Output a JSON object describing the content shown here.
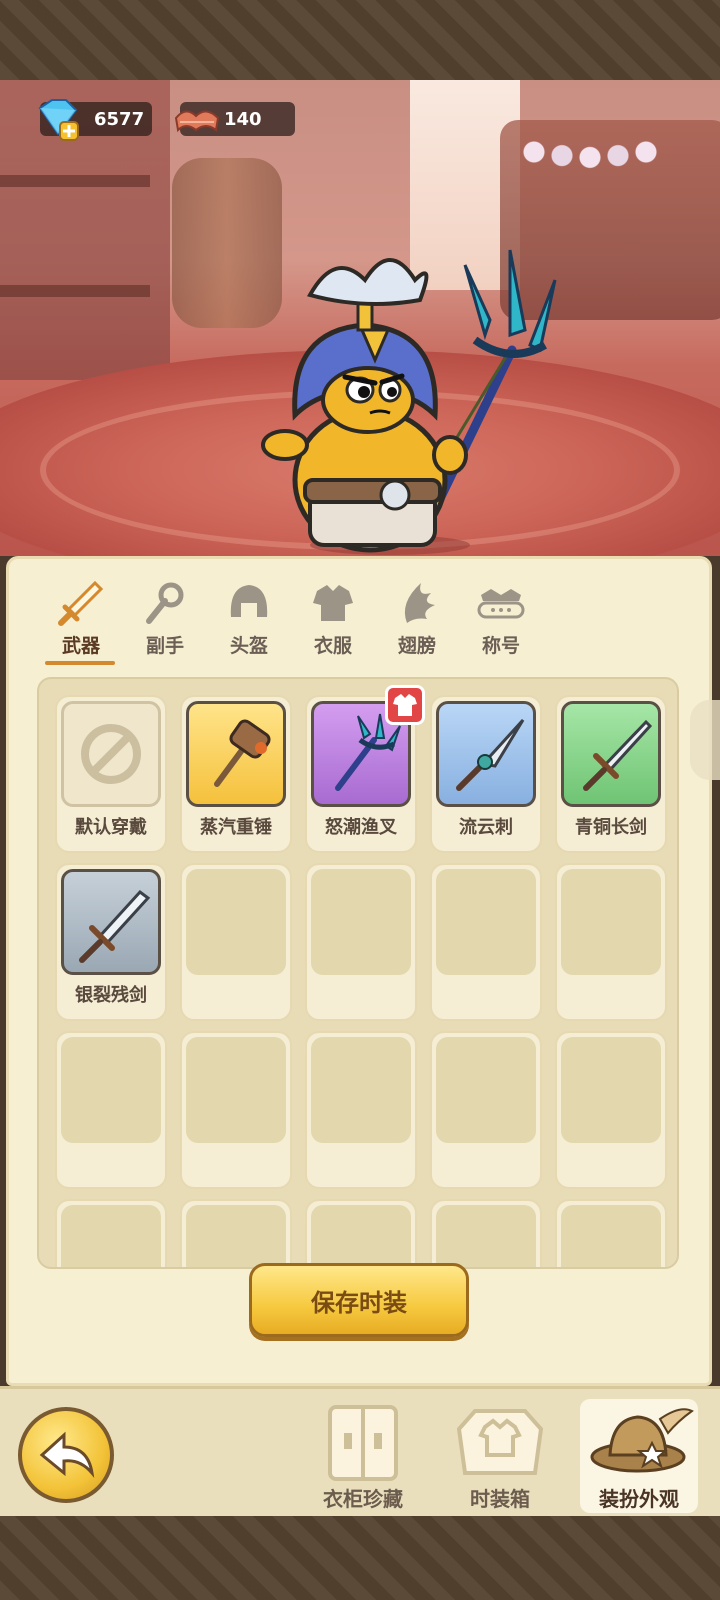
{
  "currency": {
    "gems": {
      "icon": "diamond-plus-icon",
      "value": "6577"
    },
    "fabric": {
      "icon": "cloth-roll-icon",
      "value": "140"
    }
  },
  "tabs": [
    {
      "label": "武器",
      "icon": "sword-icon",
      "active": true
    },
    {
      "label": "副手",
      "icon": "offhand-staff-icon",
      "active": false
    },
    {
      "label": "头盔",
      "icon": "helmet-icon",
      "active": false
    },
    {
      "label": "衣服",
      "icon": "armor-icon",
      "active": false
    },
    {
      "label": "翅膀",
      "icon": "wing-icon",
      "active": false
    },
    {
      "label": "称号",
      "icon": "title-crown-icon",
      "active": false
    }
  ],
  "items": [
    {
      "name": "默认穿戴",
      "icon": "none-icon",
      "rarity": "default",
      "color": "#e8dfc3"
    },
    {
      "name": "蒸汽重锤",
      "icon": "hammer-icon",
      "rarity": "gold",
      "color": "#f5c84a"
    },
    {
      "name": "怒潮渔叉",
      "icon": "trident-icon",
      "rarity": "purple",
      "color": "#b77ad9",
      "badge": "new-outfit-badge"
    },
    {
      "name": "流云刺",
      "icon": "spear-icon",
      "rarity": "blue",
      "color": "#8fb6e6"
    },
    {
      "name": "青铜长剑",
      "icon": "longsword-icon",
      "rarity": "green",
      "color": "#87d38b"
    },
    {
      "name": "银裂残剑",
      "icon": "broken-sword-icon",
      "rarity": "gray",
      "color": "#aab7c2"
    }
  ],
  "save_button": {
    "label": "保存时装"
  },
  "bottom_nav": [
    {
      "label": "衣柜珍藏",
      "icon": "wardrobe-icon",
      "active": false
    },
    {
      "label": "时装箱",
      "icon": "fashion-box-icon",
      "active": false
    },
    {
      "label": "装扮外观",
      "icon": "hat-icon",
      "active": true
    }
  ],
  "back_button": {
    "icon": "back-arrow-icon"
  }
}
